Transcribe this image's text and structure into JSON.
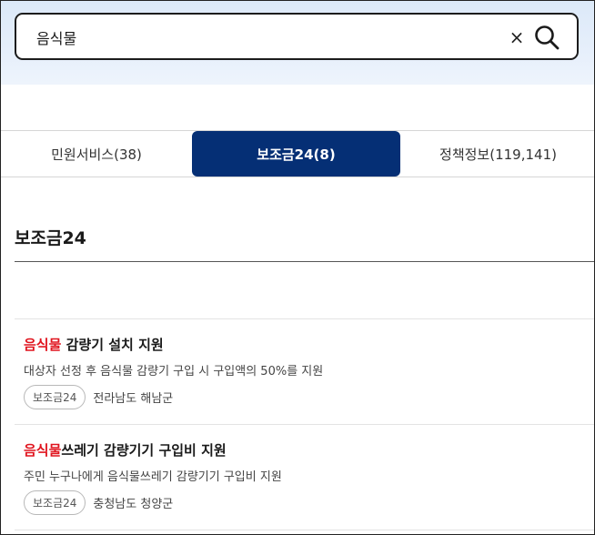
{
  "search": {
    "query": "음식물",
    "clear_label": "×"
  },
  "tabs": [
    {
      "label": "민원서비스(38)",
      "active": false
    },
    {
      "label": "보조금24(8)",
      "active": true
    },
    {
      "label": "정책정보(119,141)",
      "active": false
    }
  ],
  "section": {
    "title": "보조금24"
  },
  "results": [
    {
      "title_highlight": "음식물",
      "title_rest": " 감량기 설치 지원",
      "description": "대상자 선정 후 음식물 감량기 구입 시 구입액의 50%를 지원",
      "badge": "보조금24",
      "region": "전라남도 해남군"
    },
    {
      "title_highlight": "음식물",
      "title_rest": "쓰레기 감량기기 구입비 지원",
      "description": "주민 누구나에게 음식물쓰레기 감량기기 구입비 지원",
      "badge": "보조금24",
      "region": "충청남도 청양군"
    }
  ],
  "colors": {
    "accent": "#052f75",
    "highlight": "#e0141e"
  }
}
